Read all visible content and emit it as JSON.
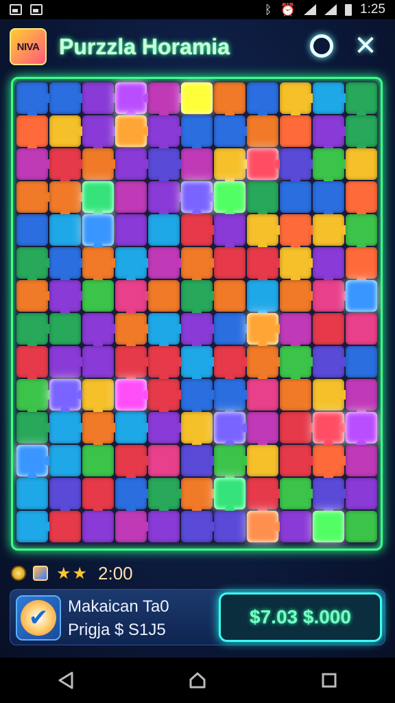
{
  "status_bar": {
    "time": "1:25"
  },
  "header": {
    "logo_text": "NIVA",
    "title": "Purzzla Horamia"
  },
  "stats": {
    "stars": "★★",
    "timer": "2:00"
  },
  "promo": {
    "line1": "Makaican Ta0",
    "line2": "Prigja $ S1J5",
    "buy_label": "$7.03 $.000"
  },
  "colors": {
    "palette": [
      "#e63a4a",
      "#f07a28",
      "#f5c02a",
      "#3cc44a",
      "#27a85a",
      "#2a6ee0",
      "#1fa8e8",
      "#8a3ad6",
      "#c03ab8",
      "#e8408a",
      "#5a4ad8",
      "#ff6a3a"
    ],
    "neon_green": "#3dff8a",
    "neon_cyan": "#3dfff0"
  },
  "icons": [
    "image-icon",
    "bluetooth-icon",
    "alarm-icon",
    "wifi-icon",
    "signal-icon",
    "battery-icon",
    "record-icon",
    "close-icon",
    "coin-icon",
    "gem-icon",
    "check-badge-icon",
    "back-icon",
    "home-icon",
    "recents-icon"
  ]
}
